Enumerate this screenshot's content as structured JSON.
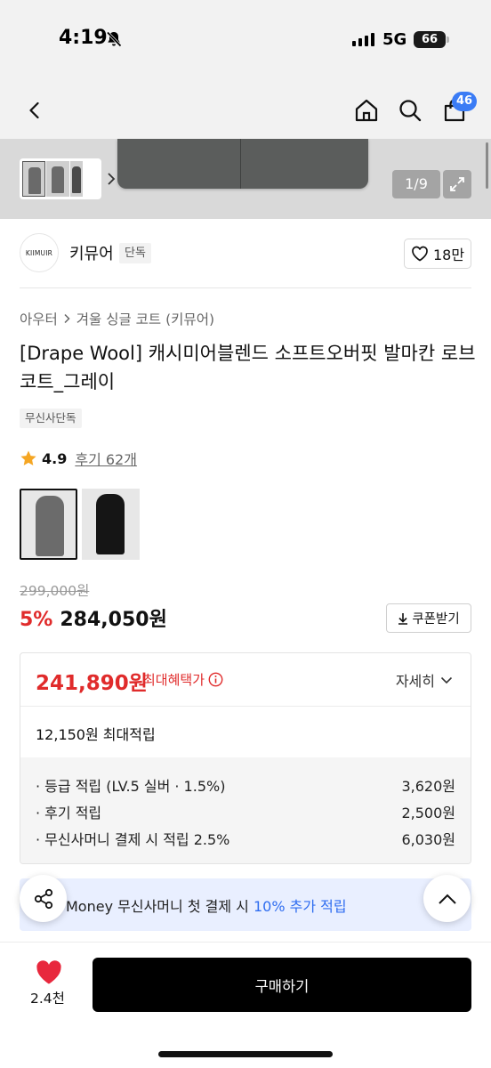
{
  "status_bar": {
    "time": "4:19",
    "network": "5G",
    "battery": "66"
  },
  "header": {
    "cart_count": "46"
  },
  "gallery": {
    "counter": "1/9"
  },
  "brand": {
    "logo_text": "KIIMUIR",
    "name": "키뮤어",
    "tag": "단독",
    "likes": "18만"
  },
  "breadcrumb": [
    "아우터",
    "겨울 싱글 코트 (키뮤어)"
  ],
  "product": {
    "title": "[Drape Wool] 캐시미어블렌드 소프트오버핏 발마칸 로브코트_그레이",
    "exclusive_tag": "무신사단독",
    "rating": "4.9",
    "review_link": "후기 62개",
    "color_options": [
      {
        "name": "grey",
        "color": "#6b6b6b",
        "selected": true
      },
      {
        "name": "black",
        "color": "#151515",
        "selected": false
      }
    ]
  },
  "price": {
    "original": "299,000원",
    "discount": "5%",
    "sale": "284,050원",
    "coupon_label": "쿠폰받기"
  },
  "benefit": {
    "max_price": "241,890원",
    "max_label": "최대혜택가",
    "detail_label": "자세히",
    "points_total": "12,150원 최대적립",
    "points": [
      {
        "label": "· 등급 적립 (LV.5 실버 · 1.5%)",
        "value": "3,620원"
      },
      {
        "label": "· 후기 적립",
        "value": "2,500원"
      },
      {
        "label": "· 무신사머니 결제 시 적립 2.5%",
        "value": "6,030원"
      }
    ]
  },
  "promo": {
    "prefix": "Money 무신사머니 첫 결제 시 ",
    "highlight": "10% 추가 적립"
  },
  "bottom": {
    "wish_count": "2.4천",
    "buy_label": "구매하기"
  },
  "colors": {
    "accent_red": "#e02b2b",
    "accent_blue": "#3b7cf5",
    "promo_bg": "#e9efff"
  }
}
